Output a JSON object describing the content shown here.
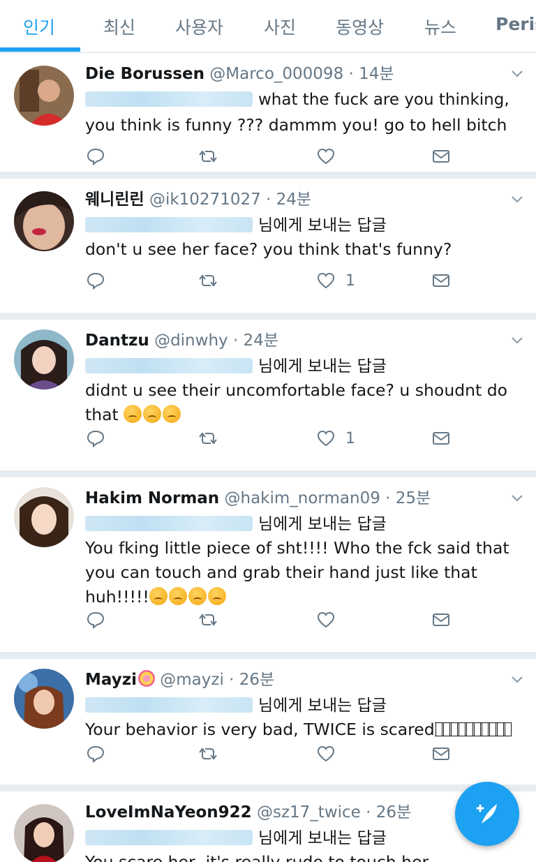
{
  "tabs": [
    {
      "label": "인기",
      "active": true
    },
    {
      "label": "최신"
    },
    {
      "label": "사용자"
    },
    {
      "label": "사진"
    },
    {
      "label": "동영상"
    },
    {
      "label": "뉴스"
    },
    {
      "label": "Peris"
    }
  ],
  "reply_label": "님에게 보내는 답글",
  "tweets": [
    {
      "name": "Die Borussen",
      "handle": "@Marco_000098 · 14분",
      "text_1": "what the fuck are you thinking,",
      "text_2": "you think is funny ??? dammm you! go to hell bitch",
      "likes": ""
    },
    {
      "name": "웨니린린",
      "handle": "@ik10271027 · 24분",
      "text": "don't u see her face? you think that's funny?",
      "likes": "1"
    },
    {
      "name": "Dantzu",
      "handle": "@dinwhy · 24분",
      "text": "didnt u see their uncomfortable face? u shoudnt do that",
      "likes": "1"
    },
    {
      "name": "Hakim Norman",
      "handle": "@hakim_norman09 · 25분",
      "text": "You fking little piece of sht!!!! Who the fck said that you can touch and grab their hand just like that huh!!!!!",
      "likes": ""
    },
    {
      "name": "Mayzi",
      "handle": "@mayzi · 26분",
      "text": "Your behavior is very bad, TWICE is scared",
      "likes": ""
    },
    {
      "name": "LoveImNaYeon922",
      "handle": "@sz17_twice · 26분",
      "text": "You scare her, it's really rude to touch her"
    }
  ],
  "colors": {
    "accent": "#1da1f2",
    "muted": "#657786",
    "divider": "#e6ecf0"
  },
  "icons": [
    "reply-icon",
    "retweet-icon",
    "like-icon",
    "direct-message-icon",
    "chevron-down-icon",
    "compose-tweet-icon"
  ]
}
